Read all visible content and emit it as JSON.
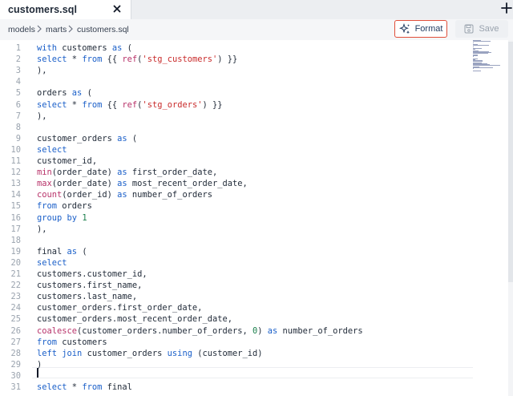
{
  "tab": {
    "label": "customers.sql"
  },
  "breadcrumb": [
    "models",
    "marts",
    "customers.sql"
  ],
  "toolbar": {
    "format_label": "Format",
    "save_label": "Save"
  },
  "colors": {
    "keyword": "#1a5fc9",
    "function": "#b8336a",
    "string": "#c92a2a",
    "number": "#1a7f4b",
    "format_outline": "#e04e39"
  },
  "icons": {
    "close": "close-icon",
    "new_tab": "plus-icon",
    "format": "sparkle-icon",
    "save": "save-disk-icon"
  },
  "editor": {
    "active_line": 30,
    "lines": [
      [
        [
          "kw",
          "with"
        ],
        [
          "op",
          " customers "
        ],
        [
          "kw",
          "as"
        ],
        [
          "op",
          " ("
        ]
      ],
      [
        [
          "kw",
          "select"
        ],
        [
          "op",
          " * "
        ],
        [
          "kw",
          "from"
        ],
        [
          "op",
          " {{ "
        ],
        [
          "fn",
          "ref"
        ],
        [
          "op",
          "("
        ],
        [
          "str",
          "'stg_customers'"
        ],
        [
          "op",
          ") }}"
        ]
      ],
      [
        [
          "op",
          "),"
        ]
      ],
      [],
      [
        [
          "op",
          "orders "
        ],
        [
          "kw",
          "as"
        ],
        [
          "op",
          " ("
        ]
      ],
      [
        [
          "kw",
          "select"
        ],
        [
          "op",
          " * "
        ],
        [
          "kw",
          "from"
        ],
        [
          "op",
          " {{ "
        ],
        [
          "fn",
          "ref"
        ],
        [
          "op",
          "("
        ],
        [
          "str",
          "'stg_orders'"
        ],
        [
          "op",
          ") }}"
        ]
      ],
      [
        [
          "op",
          "),"
        ]
      ],
      [],
      [
        [
          "op",
          "customer_orders "
        ],
        [
          "kw",
          "as"
        ],
        [
          "op",
          " ("
        ]
      ],
      [
        [
          "kw",
          "select"
        ]
      ],
      [
        [
          "op",
          "customer_id,"
        ]
      ],
      [
        [
          "fn",
          "min"
        ],
        [
          "op",
          "(order_date) "
        ],
        [
          "kw",
          "as"
        ],
        [
          "op",
          " first_order_date,"
        ]
      ],
      [
        [
          "fn",
          "max"
        ],
        [
          "op",
          "(order_date) "
        ],
        [
          "kw",
          "as"
        ],
        [
          "op",
          " most_recent_order_date,"
        ]
      ],
      [
        [
          "fn",
          "count"
        ],
        [
          "op",
          "(order_id) "
        ],
        [
          "kw",
          "as"
        ],
        [
          "op",
          " number_of_orders"
        ]
      ],
      [
        [
          "kw",
          "from"
        ],
        [
          "op",
          " orders"
        ]
      ],
      [
        [
          "kw",
          "group by"
        ],
        [
          "op",
          " "
        ],
        [
          "num",
          "1"
        ]
      ],
      [
        [
          "op",
          "),"
        ]
      ],
      [],
      [
        [
          "op",
          "final "
        ],
        [
          "kw",
          "as"
        ],
        [
          "op",
          " ("
        ]
      ],
      [
        [
          "kw",
          "select"
        ]
      ],
      [
        [
          "op",
          "customers.customer_id,"
        ]
      ],
      [
        [
          "op",
          "customers.first_name,"
        ]
      ],
      [
        [
          "op",
          "customers.last_name,"
        ]
      ],
      [
        [
          "op",
          "customer_orders.first_order_date,"
        ]
      ],
      [
        [
          "op",
          "customer_orders.most_recent_order_date,"
        ]
      ],
      [
        [
          "fn",
          "coalesce"
        ],
        [
          "op",
          "(customer_orders.number_of_orders, "
        ],
        [
          "num",
          "0"
        ],
        [
          "op",
          ") "
        ],
        [
          "kw",
          "as"
        ],
        [
          "op",
          " number_of_orders"
        ]
      ],
      [
        [
          "kw",
          "from"
        ],
        [
          "op",
          " customers"
        ]
      ],
      [
        [
          "kw",
          "left join"
        ],
        [
          "op",
          " customer_orders "
        ],
        [
          "kw",
          "using"
        ],
        [
          "op",
          " (customer_id)"
        ]
      ],
      [
        [
          "op",
          ")"
        ]
      ],
      [],
      [
        [
          "kw",
          "select"
        ],
        [
          "op",
          " * "
        ],
        [
          "kw",
          "from"
        ],
        [
          "op",
          " final"
        ]
      ]
    ]
  }
}
